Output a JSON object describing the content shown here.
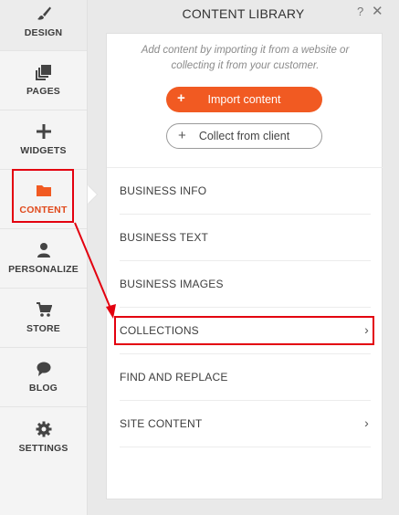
{
  "sidebar": {
    "items": [
      {
        "label": "DESIGN",
        "icon": "paintbrush-icon"
      },
      {
        "label": "PAGES",
        "icon": "pages-icon"
      },
      {
        "label": "WIDGETS",
        "icon": "plus-icon"
      },
      {
        "label": "CONTENT",
        "icon": "folder-icon",
        "active": true
      },
      {
        "label": "PERSONALIZE",
        "icon": "person-icon"
      },
      {
        "label": "STORE",
        "icon": "cart-icon"
      },
      {
        "label": "BLOG",
        "icon": "chat-bubble-icon"
      },
      {
        "label": "SETTINGS",
        "icon": "gear-icon"
      }
    ]
  },
  "panel": {
    "title": "CONTENT LIBRARY",
    "help": "?",
    "close": "✕",
    "intro": "Add content by importing it from a website or collecting it from your customer.",
    "import_button": "Import content",
    "collect_button": "Collect from client",
    "menu": [
      {
        "label": "BUSINESS INFO",
        "chevron": false
      },
      {
        "label": "BUSINESS TEXT",
        "chevron": false
      },
      {
        "label": "BUSINESS IMAGES",
        "chevron": false
      },
      {
        "label": "COLLECTIONS",
        "chevron": true
      },
      {
        "label": "FIND AND REPLACE",
        "chevron": false
      },
      {
        "label": "SITE CONTENT",
        "chevron": true
      }
    ]
  },
  "colors": {
    "accent": "#f15a22",
    "active_label": "#e0491b",
    "annotation": "#e3000f"
  }
}
